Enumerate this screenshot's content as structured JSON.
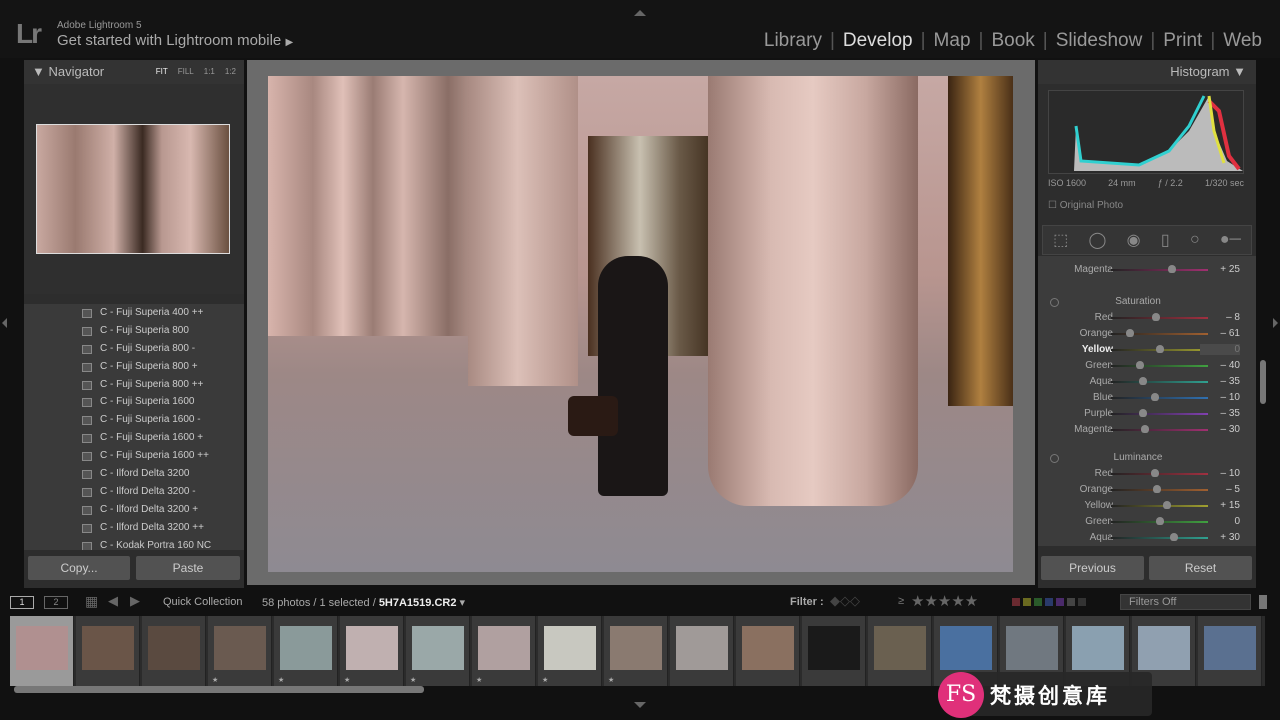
{
  "header": {
    "logo": "Lr",
    "app_name": "Adobe Lightroom 5",
    "promo": "Get started with Lightroom mobile",
    "promo_arrow": "▶",
    "modules": [
      {
        "label": "Library"
      },
      {
        "label": "Develop",
        "active": true
      },
      {
        "label": "Map"
      },
      {
        "label": "Book"
      },
      {
        "label": "Slideshow"
      },
      {
        "label": "Print"
      },
      {
        "label": "Web"
      }
    ]
  },
  "navigator": {
    "title": "Navigator",
    "zoom": [
      "FIT",
      "FILL",
      "1:1",
      "1:2"
    ]
  },
  "presets": [
    "C - Fuji Superia 400 ++",
    "C - Fuji Superia 800",
    "C - Fuji Superia 800 -",
    "C - Fuji Superia 800 +",
    "C - Fuji Superia 800 ++",
    "C - Fuji Superia 1600",
    "C - Fuji Superia 1600 -",
    "C - Fuji Superia 1600 +",
    "C - Fuji Superia 1600 ++",
    "C - Ilford Delta 3200",
    "C - Ilford Delta 3200 -",
    "C - Ilford Delta 3200 +",
    "C - Ilford Delta 3200 ++",
    "C - Kodak Portra 160 NC"
  ],
  "left_buttons": {
    "copy": "Copy...",
    "paste": "Paste"
  },
  "histogram": {
    "title": "Histogram",
    "iso": "ISO 1600",
    "focal": "24 mm",
    "aperture": "ƒ / 2.2",
    "shutter": "1/320 sec",
    "original_photo": "Original Photo"
  },
  "hue_partial": {
    "label": "Magenta",
    "value": "+ 25",
    "num": 25,
    "color": "#a03070"
  },
  "saturation": {
    "title": "Saturation",
    "rows": [
      {
        "label": "Red",
        "value": "– 8",
        "num": -8,
        "color": "#a03040"
      },
      {
        "label": "Orange",
        "value": "– 61",
        "num": -61,
        "color": "#a06030"
      },
      {
        "label": "Yellow",
        "value": "0",
        "num": 0,
        "color": "#a0a030",
        "active": true
      },
      {
        "label": "Green",
        "value": "– 40",
        "num": -40,
        "color": "#40a040"
      },
      {
        "label": "Aqua",
        "value": "– 35",
        "num": -35,
        "color": "#30a090"
      },
      {
        "label": "Blue",
        "value": "– 10",
        "num": -10,
        "color": "#3070b0"
      },
      {
        "label": "Purple",
        "value": "– 35",
        "num": -35,
        "color": "#8040b0"
      },
      {
        "label": "Magenta",
        "value": "– 30",
        "num": -30,
        "color": "#a03070"
      }
    ]
  },
  "luminance": {
    "title": "Luminance",
    "rows": [
      {
        "label": "Red",
        "value": "– 10",
        "num": -10,
        "color": "#a03040"
      },
      {
        "label": "Orange",
        "value": "– 5",
        "num": -5,
        "color": "#a06030"
      },
      {
        "label": "Yellow",
        "value": "+ 15",
        "num": 15,
        "color": "#a0a030"
      },
      {
        "label": "Green",
        "value": "0",
        "num": 0,
        "color": "#40a040"
      },
      {
        "label": "Aqua",
        "value": "+ 30",
        "num": 30,
        "color": "#30a090"
      }
    ]
  },
  "right_buttons": {
    "previous": "Previous",
    "reset": "Reset"
  },
  "filmstrip_bar": {
    "view1": "1",
    "view2": "2",
    "source": "Quick Collection",
    "count": "58 photos / 1 selected /",
    "filename": "5H7A1519.CR2",
    "filter_label": "Filter :",
    "rating_op": "≥",
    "stars": "★★★★★",
    "filters_select": "Filters Off"
  },
  "thumbs": [
    "#b09090",
    "#6a5548",
    "#5a4a40",
    "#6a5a50",
    "#8a9a9a",
    "#c0b0b0",
    "#9aa8a8",
    "#b0a0a0",
    "#c8c8c0",
    "#8a7a70",
    "#a09a98",
    "#8a7060",
    "#1a1a1a",
    "#6a6050",
    "#4a70a0",
    "#707880",
    "#8aa0b0",
    "#90a0b0",
    "#5a7090"
  ],
  "watermark": {
    "logo": "FS",
    "text": "梵摄创意库"
  }
}
